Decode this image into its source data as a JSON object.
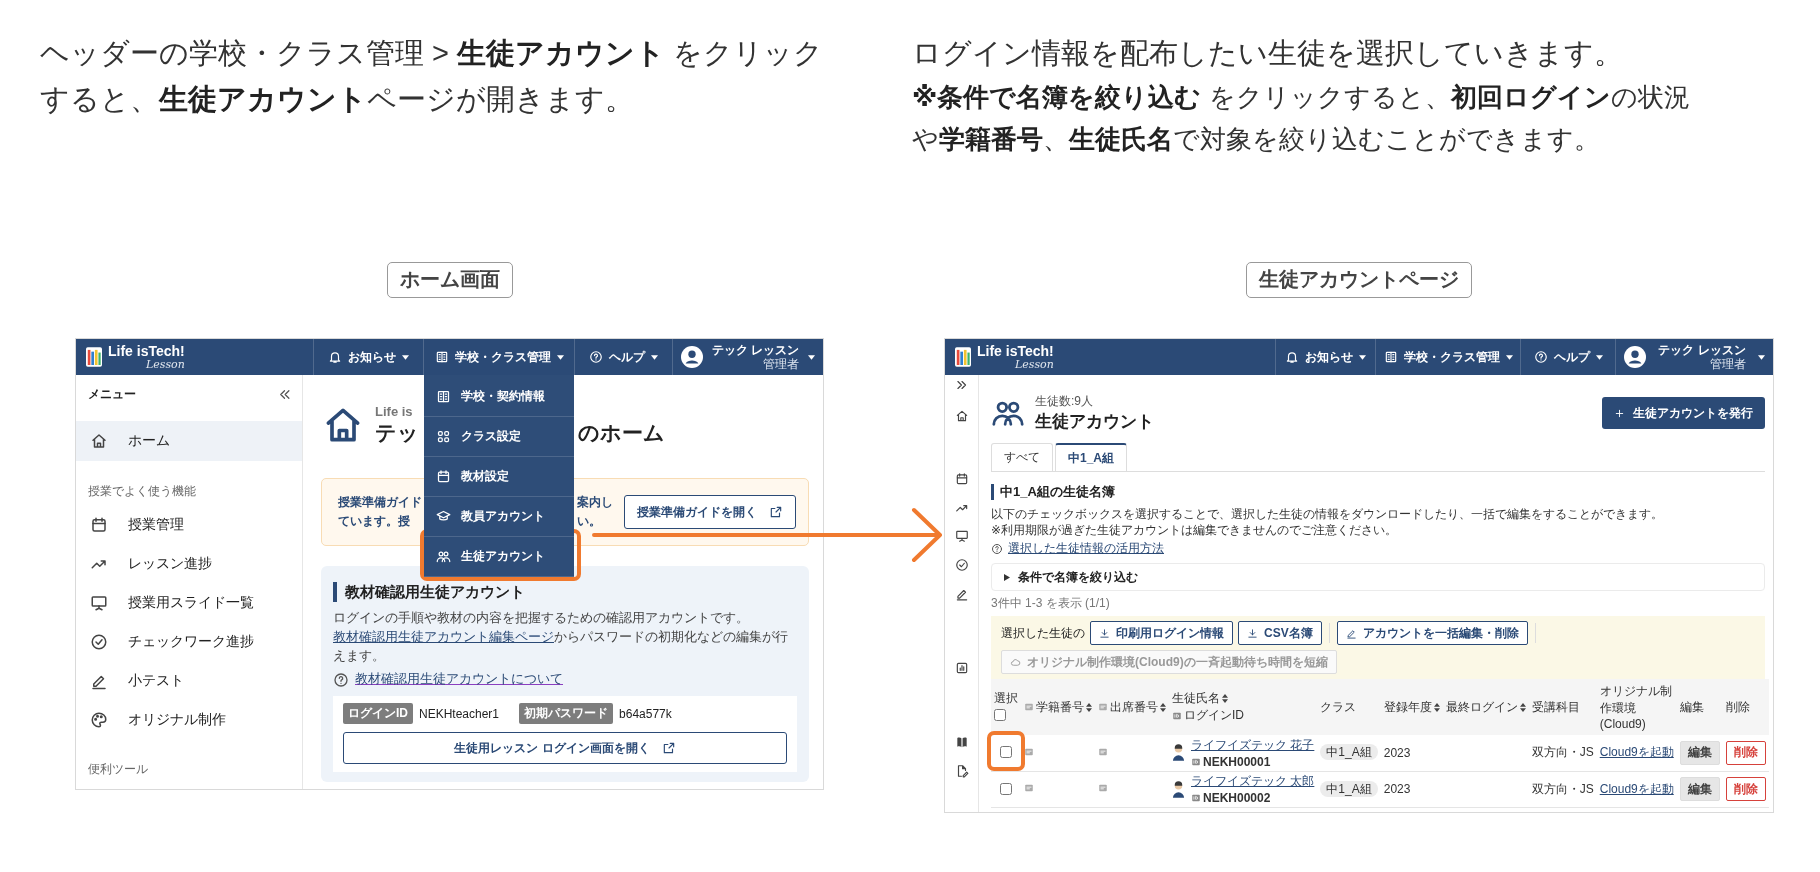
{
  "panels": [
    {
      "kind": "home",
      "intro": [
        "ヘッダーの学校・クラス管理 > **生徒アカウント** をクリックすると、**生徒アカウント**ページが開きます。"
      ],
      "caption": "ホーム画面",
      "header": {
        "logo": "Life isTech!",
        "logo_sub": "Lesson",
        "nav": [
          {
            "label": "お知らせ"
          },
          {
            "label": "学校・クラス管理"
          },
          {
            "label": "ヘルプ"
          }
        ],
        "user": {
          "name": "テック レッスン",
          "role": "管理者"
        }
      },
      "dropdown": {
        "items": [
          {
            "label": "学校・契約情報",
            "highlighted": false
          },
          {
            "label": "クラス設定",
            "highlighted": false
          },
          {
            "label": "教材設定",
            "highlighted": false
          },
          {
            "label": "教員アカウント",
            "highlighted": false
          },
          {
            "label": "生徒アカウント",
            "highlighted": true
          }
        ]
      },
      "sidebar": {
        "title": "メニュー",
        "groups": [
          {
            "items": [
              {
                "label": "ホーム",
                "selected": true
              }
            ]
          },
          {
            "heading": "授業でよく使う機能",
            "items": [
              {
                "label": "授業管理",
                "selected": false
              },
              {
                "label": "レッスン進捗",
                "selected": false
              },
              {
                "label": "授業用スライド一覧",
                "selected": false
              },
              {
                "label": "チェックワーク進捗",
                "selected": false
              },
              {
                "label": "小テスト",
                "selected": false
              },
              {
                "label": "オリジナル制作",
                "selected": false
              }
            ]
          },
          {
            "heading": "便利ツール"
          }
        ]
      },
      "main": {
        "subtitle": "Life is",
        "title_parts": [
          "テッ",
          "のホーム"
        ],
        "guide": {
          "text_left": [
            "授業準備ガイド",
            "ています。授"
          ],
          "text_right": [
            "案内し",
            "い。"
          ],
          "button": "授業準備ガイドを開く"
        },
        "card": {
          "title": "教材確認用生徒アカウント",
          "body": "ログインの手順や教材の内容を把握するための確認用アカウントです。",
          "link": "教材確認用生徒アカウント編集ページ",
          "link_after": "からパスワードの初期化などの編集が行えます。",
          "help_link": "教材確認用生徒アカウントについて",
          "credentials": [
            {
              "label": "ログインID",
              "value": "NEKHteacher1"
            },
            {
              "label": "初期パスワード",
              "value": "b64a577k"
            }
          ],
          "button": "生徒用レッスン ログイン画面を開く"
        }
      }
    },
    {
      "kind": "students",
      "intro": [
        "ログイン情報を配布したい生徒を選択していきます。",
        "**※条件で名簿を絞り込む** をクリックすると、**初回ログイン**の状況や**学籍番号**、**生徒氏名**で対象を絞り込むことができます。"
      ],
      "caption": "生徒アカウントページ",
      "header": {
        "logo": "Life isTech!",
        "logo_sub": "Lesson",
        "nav": [
          {
            "label": "お知らせ"
          },
          {
            "label": "学校・クラス管理"
          },
          {
            "label": "ヘルプ"
          }
        ],
        "user": {
          "name": "テック レッスン",
          "role": "管理者"
        }
      },
      "page": {
        "count": "生徒数:9人",
        "title": "生徒アカウント",
        "issue_button": "生徒アカウントを発行",
        "tabs": [
          {
            "label": "すべて",
            "selected": false
          },
          {
            "label": "中1_A組",
            "selected": true
          }
        ],
        "section_title": "中1_A組の生徒名簿",
        "notes": [
          "以下のチェックボックスを選択することで、選択した生徒の情報をダウンロードしたり、一括で編集をすることができます。",
          "※利用期限が過ぎた生徒アカウントは編集できませんのでご注意ください。"
        ],
        "help_link": "選択した生徒情報の活用方法",
        "filter": {
          "label": "条件で名簿を絞り込む",
          "expanded": false
        },
        "result_count": "3件中 1-3 を表示 (1/1)",
        "actions": {
          "label": "選択した生徒の",
          "buttons": [
            {
              "label": "印刷用ログイン情報",
              "kind": "download",
              "disabled": false
            },
            {
              "label": "CSV名簿",
              "kind": "download",
              "disabled": false
            },
            {
              "label": "アカウントを一括編集・削除",
              "kind": "edit",
              "disabled": false
            },
            {
              "label": "オリジナル制作環境(Cloud9)の一斉起動待ち時間を短縮",
              "kind": "cloud",
              "disabled": true
            }
          ]
        },
        "table": {
          "select_all": false,
          "columns": [
            {
              "label": "選択",
              "sortable": false
            },
            {
              "label": "学籍番号",
              "sortable": true
            },
            {
              "label": "出席番号",
              "sortable": true
            },
            {
              "label": "生徒氏名",
              "sortable": true,
              "sub": "ログインID"
            },
            {
              "label": "クラス",
              "sortable": false
            },
            {
              "label": "登録年度",
              "sortable": true
            },
            {
              "label": "最終ログイン",
              "sortable": true
            },
            {
              "label": "受講科目",
              "sortable": false
            },
            {
              "label": "オリジナル制作環境(Cloud9)",
              "sortable": false
            },
            {
              "label": "編集",
              "sortable": false
            },
            {
              "label": "削除",
              "sortable": false
            }
          ],
          "rows": [
            {
              "checked": false,
              "highlighted": true,
              "name": "ライフイズテック 花子",
              "login_id": "NEKH00001",
              "class": "中1_A組",
              "year": "2023",
              "subject": "双方向・JS",
              "cloud9": "Cloud9を起動",
              "edit": "編集",
              "delete": "削除"
            },
            {
              "checked": false,
              "highlighted": false,
              "name": "ライフイズテック 太郎",
              "login_id": "NEKH00002",
              "class": "中1_A組",
              "year": "2023",
              "subject": "双方向・JS",
              "cloud9": "Cloud9を起動",
              "edit": "編集",
              "delete": "削除"
            }
          ]
        }
      }
    }
  ]
}
